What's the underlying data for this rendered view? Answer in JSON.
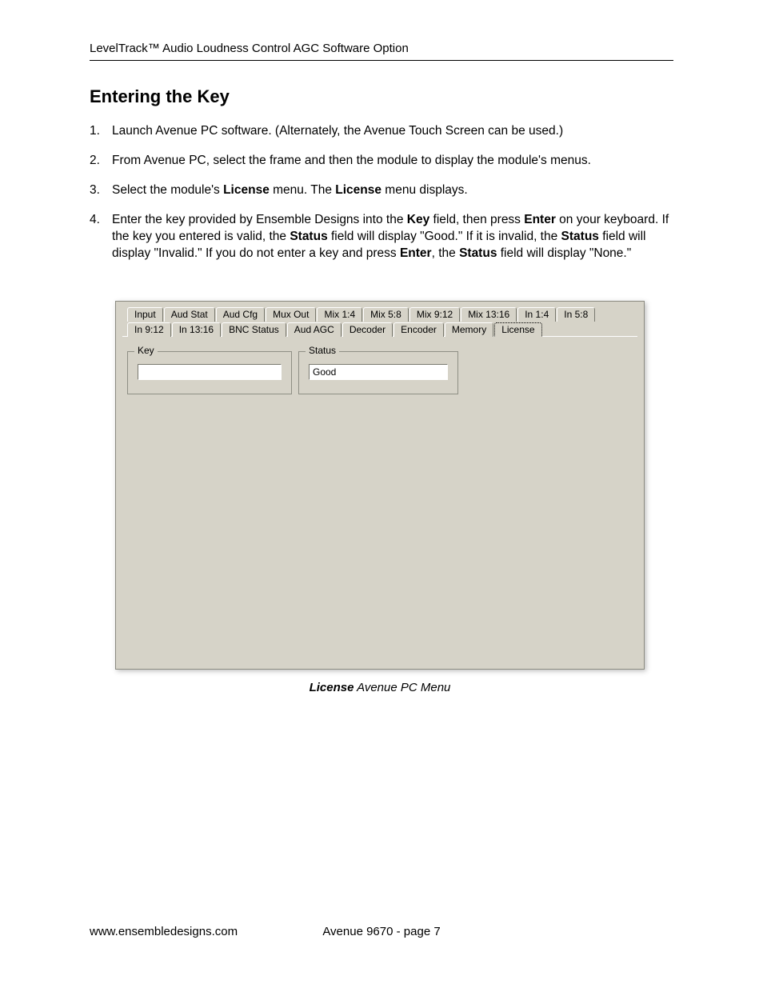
{
  "header": {
    "title": "LevelTrack™ Audio Loudness Control AGC Software Option"
  },
  "section": {
    "heading": "Entering the Key"
  },
  "steps": [
    {
      "num": "1.",
      "html": "Launch Avenue PC software. (Alternately, the Avenue Touch Screen can be used.)"
    },
    {
      "num": "2.",
      "html": "From Avenue PC, select the frame and then the module to display the module's menus."
    },
    {
      "num": "3.",
      "html": "Select the module's <strong>License</strong> menu. The <strong>License</strong> menu displays."
    },
    {
      "num": "4.",
      "html": "Enter the key provided by Ensemble Designs into the <strong>Key</strong> field, then press <strong>Enter</strong> on your keyboard. If the key you entered is valid, the <strong>Status</strong> field will display \"Good.\" If it is invalid, the <strong>Status</strong> field will display \"Invalid.\" If you do not enter a key and press <strong>Enter</strong>, the <strong>Status</strong> field will display \"None.\""
    }
  ],
  "panel": {
    "tabs_row1": [
      "Input",
      "Aud Stat",
      "Aud Cfg",
      "Mux Out",
      "Mix 1:4",
      "Mix 5:8",
      "Mix 9:12",
      "Mix 13:16",
      "In 1:4",
      "In 5:8"
    ],
    "tabs_row2": [
      "In 9:12",
      "In 13:16",
      "BNC Status",
      "Aud AGC",
      "Decoder",
      "Encoder",
      "Memory",
      "License"
    ],
    "active_tab": "License",
    "group_key_label": "Key",
    "group_status_label": "Status",
    "key_value": "",
    "status_value": "Good"
  },
  "caption": {
    "bold": "License",
    "rest": " Avenue PC Menu"
  },
  "footer": {
    "url": "www.ensembledesigns.com",
    "page": "Avenue 9670 - page 7"
  }
}
